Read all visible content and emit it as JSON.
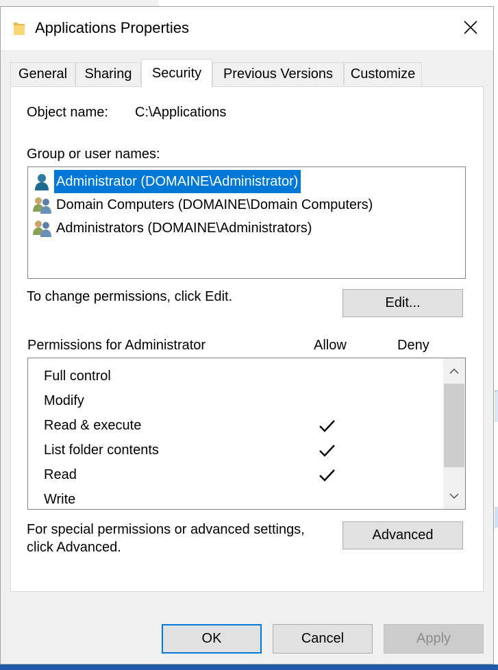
{
  "window": {
    "title": "Applications Properties"
  },
  "tabs": [
    "General",
    "Sharing",
    "Security",
    "Previous Versions",
    "Customize"
  ],
  "object": {
    "label": "Object name:",
    "value": "C:\\Applications"
  },
  "group_label": "Group or user names:",
  "users": [
    {
      "name": "Administrator (DOMAINE\\Administrator)",
      "icon": "user-icon",
      "selected": true
    },
    {
      "name": "Domain Computers (DOMAINE\\Domain Computers)",
      "icon": "group-icon",
      "selected": false
    },
    {
      "name": "Administrators (DOMAINE\\Administrators)",
      "icon": "group-icon",
      "selected": false
    }
  ],
  "change_text": "To change permissions, click Edit.",
  "edit_button": "Edit...",
  "permissions": {
    "header": "Permissions for Administrator",
    "allow_label": "Allow",
    "deny_label": "Deny",
    "rows": [
      {
        "name": "Full control",
        "allow": false,
        "deny": false
      },
      {
        "name": "Modify",
        "allow": false,
        "deny": false
      },
      {
        "name": "Read & execute",
        "allow": true,
        "deny": false
      },
      {
        "name": "List folder contents",
        "allow": true,
        "deny": false
      },
      {
        "name": "Read",
        "allow": true,
        "deny": false
      },
      {
        "name": "Write",
        "allow": false,
        "deny": false
      }
    ]
  },
  "special": {
    "line1": "For special permissions or advanced settings,",
    "line2": "click Advanced."
  },
  "advanced_button": "Advanced",
  "buttons": {
    "ok": "OK",
    "cancel": "Cancel",
    "apply": "Apply"
  },
  "colors": {
    "accent": "#0078d7",
    "selection": "#0078d7"
  }
}
